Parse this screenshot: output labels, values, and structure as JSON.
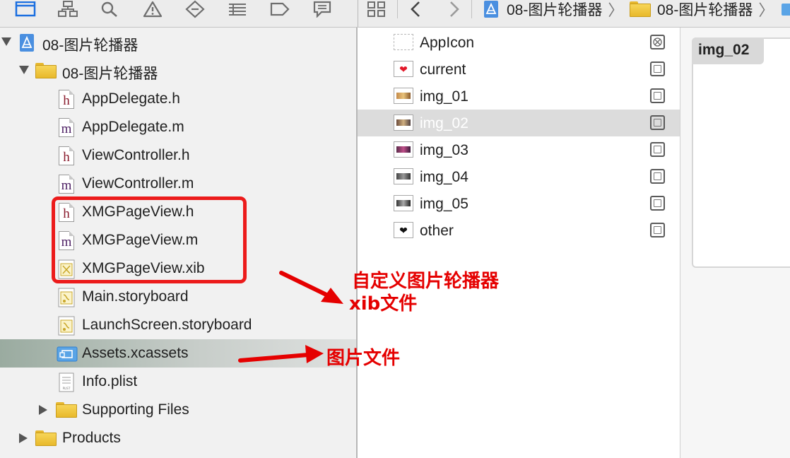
{
  "toolbar": {
    "icons": [
      "project-navigator-icon",
      "symbol-navigator-icon",
      "find-navigator-icon",
      "issue-navigator-icon",
      "test-navigator-icon",
      "debug-navigator-icon",
      "breakpoint-navigator-icon",
      "report-navigator-icon"
    ]
  },
  "jumpbar": {
    "project": "08-图片轮播器",
    "group": "08-图片轮播器"
  },
  "navigator": {
    "project": "08-图片轮播器",
    "group": "08-图片轮播器",
    "files": [
      {
        "label": "AppDelegate.h",
        "type": "h"
      },
      {
        "label": "AppDelegate.m",
        "type": "m"
      },
      {
        "label": "ViewController.h",
        "type": "h"
      },
      {
        "label": "ViewController.m",
        "type": "m"
      },
      {
        "label": "XMGPageView.h",
        "type": "h"
      },
      {
        "label": "XMGPageView.m",
        "type": "m"
      },
      {
        "label": "XMGPageView.xib",
        "type": "xib"
      },
      {
        "label": "Main.storyboard",
        "type": "storyboard"
      },
      {
        "label": "LaunchScreen.storyboard",
        "type": "storyboard"
      },
      {
        "label": "Assets.xcassets",
        "type": "xcassets",
        "selected": true
      },
      {
        "label": "Info.plist",
        "type": "plist"
      }
    ],
    "supporting": "Supporting Files",
    "products": "Products"
  },
  "assets": {
    "items": [
      {
        "label": "AppIcon",
        "selected": false
      },
      {
        "label": "current",
        "selected": false
      },
      {
        "label": "img_01",
        "selected": false
      },
      {
        "label": "img_02",
        "selected": true
      },
      {
        "label": "img_03",
        "selected": false
      },
      {
        "label": "img_04",
        "selected": false
      },
      {
        "label": "img_05",
        "selected": false
      },
      {
        "label": "other",
        "selected": false
      }
    ]
  },
  "detail": {
    "title": "img_02"
  },
  "annotations": {
    "xib_line1": "自定义图片轮播器",
    "xib_line2": "xib文件",
    "assets_note": "图片文件",
    "color": "#e50000"
  },
  "colors": {
    "selection_asset": "#dcdcdc",
    "highlight": "#ec1b1b",
    "folder": "#f2c94c"
  }
}
